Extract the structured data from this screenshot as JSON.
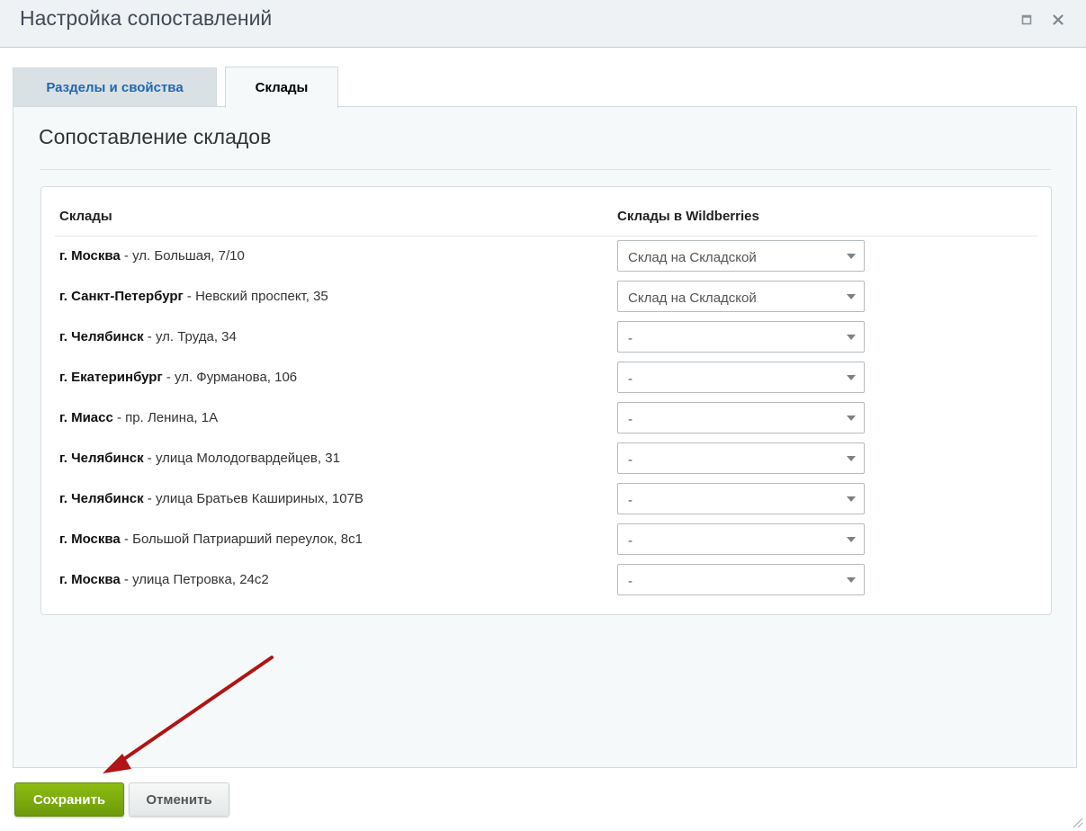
{
  "dialog": {
    "title": "Настройка сопоставлений"
  },
  "tabs": [
    {
      "label": "Разделы и свойства",
      "active": false
    },
    {
      "label": "Склады",
      "active": true
    }
  ],
  "section": {
    "heading": "Сопоставление складов"
  },
  "table": {
    "headers": {
      "stores": "Склады",
      "wildberries": "Склады в Wildberries"
    },
    "rows": [
      {
        "city": "г. Москва",
        "address": " - ул. Большая, 7/10",
        "select_value": "Склад на Складской"
      },
      {
        "city": "г. Санкт-Петербург",
        "address": " - Невский проспект, 35",
        "select_value": "Склад на Складской"
      },
      {
        "city": "г. Челябинск",
        "address": " - ул. Труда, 34",
        "select_value": "-"
      },
      {
        "city": "г. Екатеринбург",
        "address": " - ул. Фурманова, 106",
        "select_value": "-"
      },
      {
        "city": "г. Миасс",
        "address": " - пр. Ленина, 1А",
        "select_value": "-"
      },
      {
        "city": "г. Челябинск",
        "address": " - улица Молодогвардейцев, 31",
        "select_value": "-"
      },
      {
        "city": "г. Челябинск",
        "address": " - улица Братьев Кашириных, 107В",
        "select_value": "-"
      },
      {
        "city": "г. Москва",
        "address": " - Большой Патриарший переулок, 8с1",
        "select_value": "-"
      },
      {
        "city": "г. Москва",
        "address": " - улица Петровка, 24с2",
        "select_value": "-"
      }
    ]
  },
  "buttons": {
    "save": "Сохранить",
    "cancel": "Отменить"
  },
  "colors": {
    "save_button": "#7aaa0e",
    "tab_link": "#2067b0",
    "annotation_arrow": "#b01414"
  },
  "icons": {
    "maximize": "maximize-icon",
    "close": "close-icon",
    "select_caret": "chevron-down-icon",
    "annotation": "annotation-arrow"
  }
}
